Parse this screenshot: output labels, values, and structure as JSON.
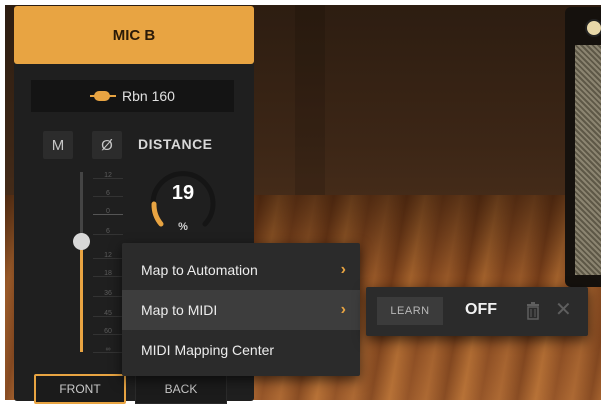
{
  "mic_panel": {
    "title": "MIC B",
    "model_name": "Rbn 160",
    "mute_label": "M",
    "phase_label": "Ø",
    "distance_label": "DISTANCE",
    "distance_value": "19",
    "distance_unit": "%",
    "fader_scale": [
      "12",
      "6",
      "0",
      "6",
      "12",
      "18",
      "36",
      "45",
      "60",
      "∞"
    ],
    "positions": [
      {
        "label": "FRONT",
        "selected": true
      },
      {
        "label": "BACK",
        "selected": false
      }
    ]
  },
  "context_menu": {
    "items": [
      {
        "label": "Map to Automation",
        "has_submenu": true
      },
      {
        "label": "Map to MIDI",
        "has_submenu": true,
        "active": true
      },
      {
        "label": "MIDI Mapping Center",
        "has_submenu": false
      }
    ],
    "arrow_glyph": "›"
  },
  "midi_submenu": {
    "learn_label": "LEARN",
    "mapping_value": "OFF",
    "close_glyph": "✕"
  },
  "colors": {
    "accent": "#e8a442",
    "panel": "#1f1f1f",
    "menu": "#2b2b2b"
  },
  "icons": [
    "ribbon-mic-icon",
    "chevron-right-icon",
    "trash-icon",
    "close-icon"
  ]
}
